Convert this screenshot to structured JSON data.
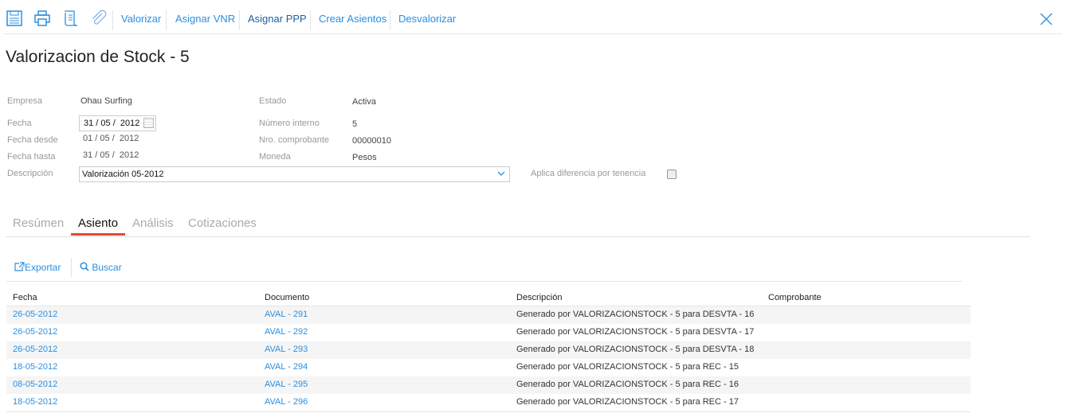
{
  "toolbar": {
    "buttons": [
      "Valorizar",
      "Asignar VNR",
      "Asignar PPP",
      "Crear Asientos",
      "Desvalorizar"
    ]
  },
  "title": "Valorizacion de Stock - 5",
  "form": {
    "empresa_label": "Empresa",
    "empresa": "Ohau Surfing",
    "fecha_label": "Fecha",
    "fecha": "31 / 05 /  2012",
    "fecha_desde_label": "Fecha desde",
    "fecha_desde": "01 / 05 /  2012",
    "fecha_hasta_label": "Fecha hasta",
    "fecha_hasta": "31 / 05 /  2012",
    "descripcion_label": "Descripción",
    "descripcion": "Valorización 05-2012",
    "estado_label": "Estado",
    "estado": "Activa",
    "numero_label": "Número interno",
    "numero": "5",
    "nro_comp_label": "Nro. comprobante",
    "nro_comp": "00000010",
    "moneda_label": "Moneda",
    "moneda": "Pesos",
    "aplica_label": "Aplica diferencia por tenencia"
  },
  "tabs": [
    "Resúmen",
    "Asiento",
    "Análisis",
    "Cotizaciones"
  ],
  "actions": {
    "exportar": "Exportar",
    "buscar": "Buscar"
  },
  "table": {
    "headers": [
      "Fecha",
      "Documento",
      "Descripción",
      "Comprobante"
    ],
    "rows": [
      [
        "26-05-2012",
        "AVAL - 291",
        "Generado por VALORIZACIONSTOCK - 5 para DESVTA - 16",
        ""
      ],
      [
        "26-05-2012",
        "AVAL - 292",
        "Generado por VALORIZACIONSTOCK - 5 para DESVTA - 17",
        ""
      ],
      [
        "26-05-2012",
        "AVAL - 293",
        "Generado por VALORIZACIONSTOCK - 5 para DESVTA - 18",
        ""
      ],
      [
        "18-05-2012",
        "AVAL - 294",
        "Generado por VALORIZACIONSTOCK - 5 para REC - 15",
        ""
      ],
      [
        "08-05-2012",
        "AVAL - 295",
        "Generado por VALORIZACIONSTOCK - 5 para REC - 16",
        ""
      ],
      [
        "18-05-2012",
        "AVAL - 296",
        "Generado por VALORIZACIONSTOCK - 5 para REC - 17",
        ""
      ]
    ]
  }
}
